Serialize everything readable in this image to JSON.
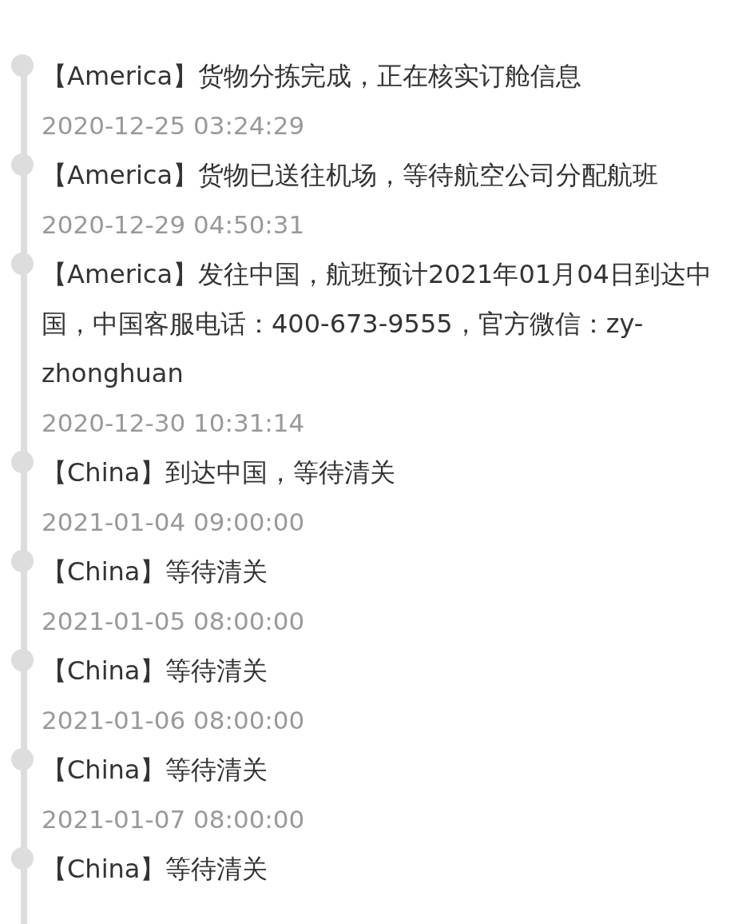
{
  "events": [
    {
      "text": "【America】货物分拣完成，正在核实订舱信息",
      "time": "2020-12-25 03:24:29"
    },
    {
      "text": "【America】货物已送往机场，等待航空公司分配航班",
      "time": "2020-12-29 04:50:31"
    },
    {
      "text": "【America】发往中国，航班预计2021年01月04日到达中国，中国客服电话：400-673-9555，官方微信：zy-zhonghuan",
      "time": "2020-12-30 10:31:14"
    },
    {
      "text": "【China】到达中国，等待清关",
      "time": "2021-01-04 09:00:00"
    },
    {
      "text": "【China】等待清关",
      "time": "2021-01-05 08:00:00"
    },
    {
      "text": "【China】等待清关",
      "time": "2021-01-06 08:00:00"
    },
    {
      "text": "【China】等待清关",
      "time": "2021-01-07 08:00:00"
    },
    {
      "text": "【China】等待清关"
    }
  ]
}
